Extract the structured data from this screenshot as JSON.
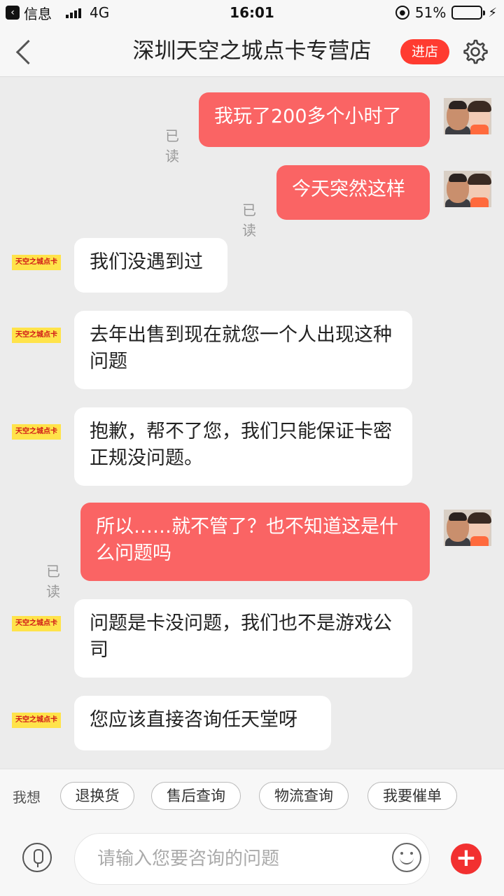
{
  "status_bar": {
    "back_app": "信息",
    "network": "4G",
    "time": "16:01",
    "battery": "51%",
    "battery_level": 0.51
  },
  "header": {
    "title": "深圳天空之城点卡专营店",
    "enter_shop": "进店"
  },
  "shop_avatar_text": "天空之城点卡",
  "messages": [
    {
      "side": "out",
      "text": "我玩了200多个小时了",
      "read": "已读"
    },
    {
      "side": "out",
      "text": "今天突然这样",
      "read": "已读"
    },
    {
      "side": "in",
      "text": "我们没遇到过"
    },
    {
      "side": "in",
      "text": "去年出售到现在就您一个人出现这种问题"
    },
    {
      "side": "in",
      "text": "抱歉，帮不了您，我们只能保证卡密正规没问题。"
    },
    {
      "side": "out",
      "text": "所以……就不管了？也不知道这是什么问题吗",
      "read": "已读"
    },
    {
      "side": "in",
      "text": "问题是卡没问题，我们也不是游戏公司"
    },
    {
      "side": "in",
      "text": "您应该直接咨询任天堂呀"
    }
  ],
  "quick_bar": {
    "label": "我想",
    "chips": [
      "退换货",
      "售后查询",
      "物流查询",
      "我要催单"
    ]
  },
  "input": {
    "placeholder": "请输入您要咨询的问题"
  },
  "colors": {
    "accent": "#ff3b30",
    "outgoing_bubble": "#fa6464",
    "incoming_bubble": "#ffffff",
    "background": "#ececec"
  }
}
